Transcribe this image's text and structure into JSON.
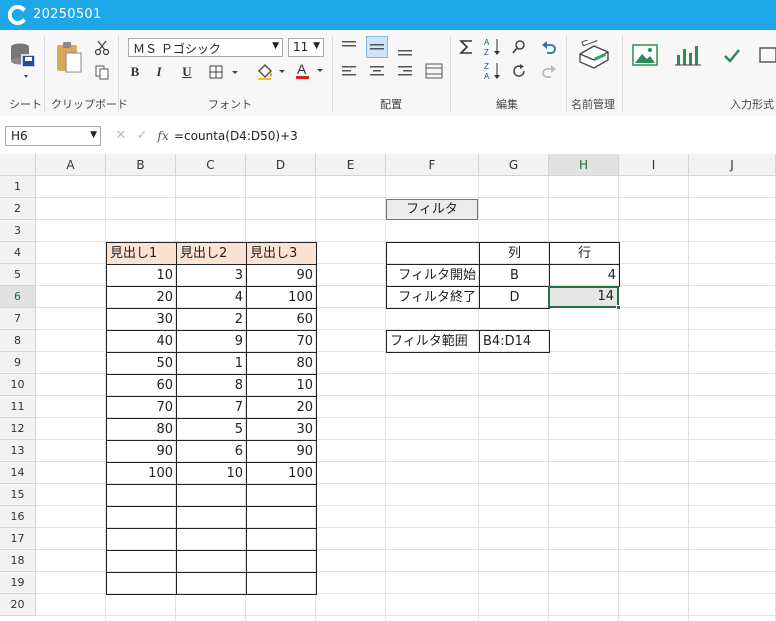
{
  "window": {
    "title": "20250501"
  },
  "ribbon": {
    "groups": [
      {
        "id": "sheet",
        "label": "シート"
      },
      {
        "id": "clipboard",
        "label": "クリップボード"
      },
      {
        "id": "font",
        "label": "フォント"
      },
      {
        "id": "alignment",
        "label": "配置"
      },
      {
        "id": "edit",
        "label": "編集"
      },
      {
        "id": "names",
        "label": "名前管理"
      },
      {
        "id": "input",
        "label": "入力形式"
      }
    ],
    "font_name": "ＭＳ Ｐゴシック",
    "font_size": "11",
    "bold_label": "B",
    "italic_label": "I",
    "underline_label": "U",
    "accent_font_color": "#e02020"
  },
  "formula_bar": {
    "name_box": "H6",
    "formula": "=counta(D4:D50)+3"
  },
  "grid": {
    "columns": [
      "A",
      "B",
      "C",
      "D",
      "E",
      "F",
      "G",
      "H",
      "I",
      "J"
    ],
    "rows": [
      "1",
      "2",
      "3",
      "4",
      "5",
      "6",
      "7",
      "8",
      "9",
      "10",
      "11",
      "12",
      "13",
      "14",
      "15",
      "16",
      "17",
      "18",
      "19",
      "20"
    ],
    "selected_column": "H",
    "selected_row": "6"
  },
  "sheet": {
    "table_headers": [
      "見出し1",
      "見出し2",
      "見出し3"
    ],
    "table_rows": [
      [
        "10",
        "3",
        "90"
      ],
      [
        "20",
        "4",
        "100"
      ],
      [
        "30",
        "2",
        "60"
      ],
      [
        "40",
        "9",
        "70"
      ],
      [
        "50",
        "1",
        "80"
      ],
      [
        "60",
        "8",
        "10"
      ],
      [
        "70",
        "7",
        "20"
      ],
      [
        "80",
        "5",
        "30"
      ],
      [
        "90",
        "6",
        "90"
      ],
      [
        "100",
        "10",
        "100"
      ]
    ],
    "filter_button_label": "フィルタ",
    "filter_table": {
      "col_header": "列",
      "row_header": "行",
      "start_label": "フィルタ開始",
      "start_col": "B",
      "start_row": "4",
      "end_label": "フィルタ終了",
      "end_col": "D",
      "end_row": "14"
    },
    "range_label": "フィルタ範囲",
    "range_value": "B4:D14"
  }
}
